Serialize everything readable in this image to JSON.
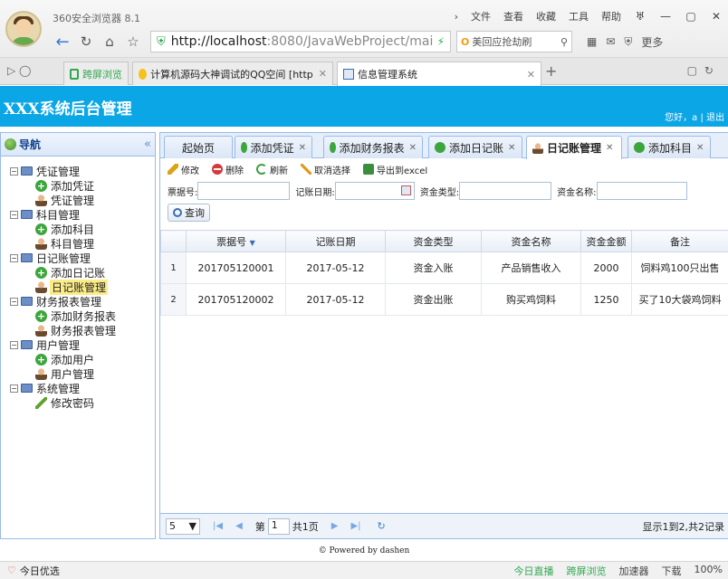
{
  "browser": {
    "name": "360安全浏览器 8.1",
    "menu": [
      "文件",
      "查看",
      "收藏",
      "工具",
      "帮助"
    ],
    "url_host": "http://localhost",
    "url_rest": ":8080/JavaWebProject/main.j",
    "search_text": "美回应抢劫刷",
    "nav_more": "更多",
    "tabs": [
      {
        "label": "跨屏浏览"
      },
      {
        "label": "计算机源码大神调试的QQ空间 [http"
      },
      {
        "label": "信息管理系统"
      }
    ],
    "status_left": "今日优选",
    "status_items": [
      "今日直播",
      "跨屏浏览",
      "加速器",
      "下载",
      "100%"
    ]
  },
  "app": {
    "title": "XXX系统后台管理",
    "welcome": "您好，a | 退出"
  },
  "sidebar": {
    "title": "导航",
    "collapse": "«",
    "groups": [
      {
        "label": "凭证管理",
        "items": [
          "添加凭证",
          "凭证管理"
        ]
      },
      {
        "label": "科目管理",
        "items": [
          "添加科目",
          "科目管理"
        ]
      },
      {
        "label": "日记账管理",
        "items": [
          "添加日记账",
          "日记账管理"
        ]
      },
      {
        "label": "财务报表管理",
        "items": [
          "添加财务报表",
          "财务报表管理"
        ]
      },
      {
        "label": "用户管理",
        "items": [
          "添加用户",
          "用户管理"
        ]
      },
      {
        "label": "系统管理",
        "items": [
          "修改密码"
        ]
      }
    ]
  },
  "tabs": [
    {
      "label": "起始页"
    },
    {
      "label": "添加凭证"
    },
    {
      "label": "添加财务报表"
    },
    {
      "label": "添加日记账"
    },
    {
      "label": "日记账管理"
    },
    {
      "label": "添加科目"
    }
  ],
  "toolbar": {
    "edit": "修改",
    "delete": "删除",
    "refresh": "刷新",
    "cancel": "取消选择",
    "export": "导出到excel"
  },
  "filters": {
    "bill_no": "票据号:",
    "date": "记账日期:",
    "fund_type": "资金类型:",
    "fund_name": "资金名称:",
    "search": "查询"
  },
  "grid": {
    "columns": [
      "票据号",
      "记账日期",
      "资金类型",
      "资金名称",
      "资金金额",
      "备注"
    ],
    "rows": [
      {
        "n": "1",
        "bill": "201705120001",
        "date": "2017-05-12",
        "type": "资金入账",
        "name": "产品销售收入",
        "amount": "2000",
        "note": "饲料鸡100只出售"
      },
      {
        "n": "2",
        "bill": "201705120002",
        "date": "2017-05-12",
        "type": "资金出账",
        "name": "购买鸡饲料",
        "amount": "1250",
        "note": "买了10大袋鸡饲料"
      }
    ]
  },
  "pager": {
    "page_size": "5",
    "page_label_pre": "第",
    "page_value": "1",
    "page_label_post": "共1页",
    "info": "显示1到2,共2记录"
  },
  "footer": "© Powered by dashen"
}
